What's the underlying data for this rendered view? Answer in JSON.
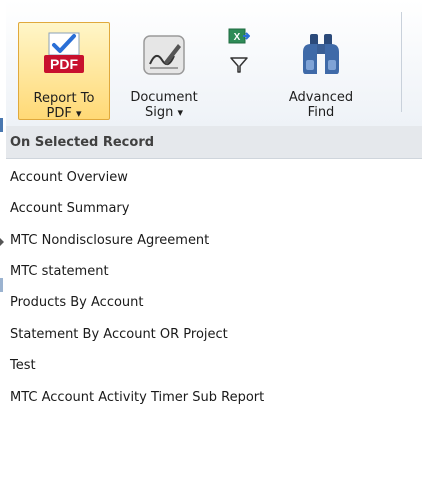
{
  "ribbon": {
    "report_to_pdf": {
      "label": "Report To",
      "sub": "PDF",
      "arrow": "▾",
      "icon": "pdf-report-icon"
    },
    "document_sign": {
      "label": "Document",
      "sub": "Sign",
      "arrow": "▾",
      "icon": "signature-icon"
    },
    "advanced_find": {
      "label": "Advanced",
      "sub": "Find",
      "icon": "binoculars-icon"
    },
    "small_icons": [
      "excel-export-icon",
      "filter-icon"
    ]
  },
  "menu": {
    "header": "On Selected Record",
    "items": [
      "Account Overview",
      "Account Summary",
      "MTC Nondisclosure Agreement",
      "MTC statement",
      "Products By Account",
      "Statement By Account OR Project",
      "Test",
      "MTC Account Activity Timer Sub Report"
    ]
  },
  "colors": {
    "selected_button_bg": "#ffd976",
    "menu_header_bg": "#e5e8ec",
    "pdf_red": "#c8102e"
  }
}
